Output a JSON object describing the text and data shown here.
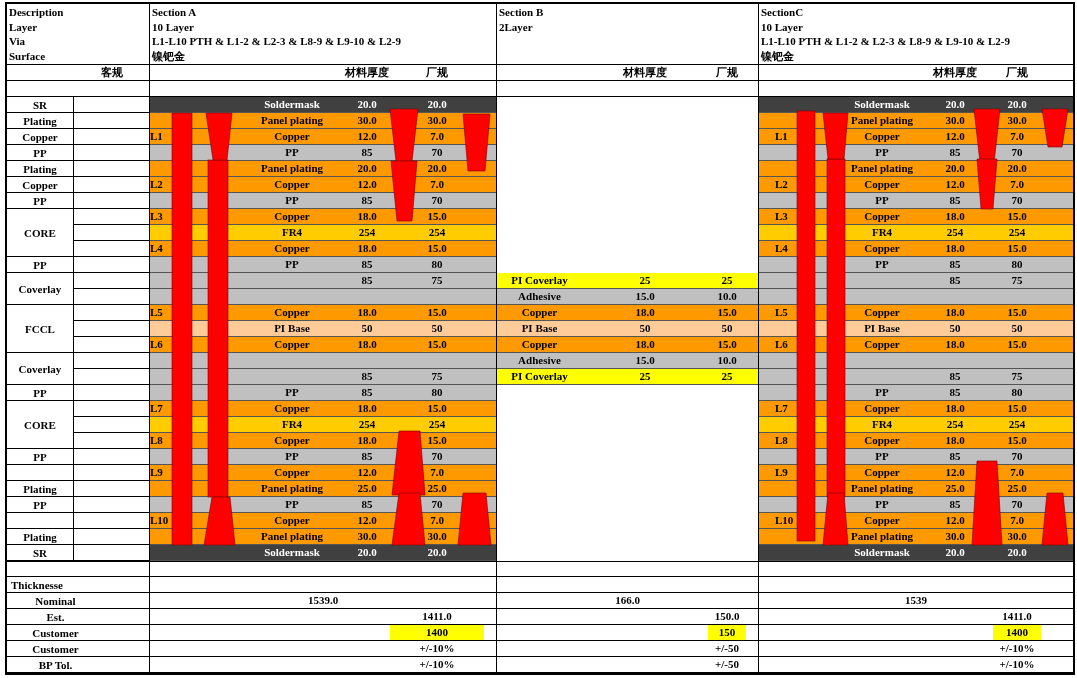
{
  "description_labels": [
    "Description",
    "Layer",
    "Via",
    "Surface"
  ],
  "customer_spec_heading": "客规",
  "stack_labels": [
    {
      "text": "SR"
    },
    {
      "text": "Plating"
    },
    {
      "text": "Copper"
    },
    {
      "text": "PP"
    },
    {
      "text": "Plating"
    },
    {
      "text": "Copper"
    },
    {
      "text": "PP"
    },
    {
      "text": "CORE"
    },
    {
      "text": "PP"
    },
    {
      "text": "Coverlay"
    },
    {
      "text": "FCCL"
    },
    {
      "text": "Coverlay"
    },
    {
      "text": "PP"
    },
    {
      "text": "CORE"
    },
    {
      "text": "PP"
    },
    {
      "text": "Plating"
    },
    {
      "text": "PP"
    },
    {
      "text": "Plating"
    },
    {
      "text": "SR"
    }
  ],
  "sections": [
    {
      "title": "Section A",
      "layers": "10 Layer",
      "via": "L1-L10 PTH  & L1-2 & L2-3 & L8-9 & L9-10 & L2-9",
      "surface": "镍钯金",
      "thickness_heading": "材料厚度",
      "factory_heading": "厂规",
      "rows": [
        {
          "kind": "soldermask",
          "material": "Soldermask",
          "thickness": "20.0",
          "factory": "20.0"
        },
        {
          "kind": "plating",
          "material": "Panel plating",
          "thickness": "30.0",
          "factory": "30.0"
        },
        {
          "kind": "copper",
          "layer": "L1",
          "material": "Copper",
          "thickness": "12.0",
          "factory": "7.0"
        },
        {
          "kind": "pp",
          "material": "PP",
          "thickness": "85",
          "factory": "70"
        },
        {
          "kind": "plating",
          "material": "Panel plating",
          "thickness": "20.0",
          "factory": "20.0"
        },
        {
          "kind": "copper",
          "layer": "L2",
          "material": "Copper",
          "thickness": "12.0",
          "factory": "7.0"
        },
        {
          "kind": "pp",
          "material": "PP",
          "thickness": "85",
          "factory": "70"
        },
        {
          "kind": "copper",
          "layer": "L3",
          "material": "Copper",
          "thickness": "18.0",
          "factory": "15.0"
        },
        {
          "kind": "fr4",
          "material": "FR4",
          "thickness": "254",
          "factory": "254"
        },
        {
          "kind": "copper",
          "layer": "L4",
          "material": "Copper",
          "thickness": "18.0",
          "factory": "15.0"
        },
        {
          "kind": "pp",
          "material": "PP",
          "thickness": "85",
          "factory": "80"
        },
        {
          "kind": "pp",
          "thickness": "85",
          "factory": "75"
        },
        {
          "kind": "pp"
        },
        {
          "kind": "copper",
          "layer": "L5",
          "material": "Copper",
          "thickness": "18.0",
          "factory": "15.0"
        },
        {
          "kind": "pi_base",
          "material": "PI Base",
          "thickness": "50",
          "factory": "50"
        },
        {
          "kind": "copper",
          "layer": "L6",
          "material": "Copper",
          "thickness": "18.0",
          "factory": "15.0"
        },
        {
          "kind": "pp"
        },
        {
          "kind": "pp",
          "thickness": "85",
          "factory": "75"
        },
        {
          "kind": "pp",
          "material": "PP",
          "thickness": "85",
          "factory": "80"
        },
        {
          "kind": "copper",
          "layer": "L7",
          "material": "Copper",
          "thickness": "18.0",
          "factory": "15.0"
        },
        {
          "kind": "fr4",
          "material": "FR4",
          "thickness": "254",
          "factory": "254"
        },
        {
          "kind": "copper",
          "layer": "L8",
          "material": "Copper",
          "thickness": "18.0",
          "factory": "15.0"
        },
        {
          "kind": "pp",
          "material": "PP",
          "thickness": "85",
          "factory": "70"
        },
        {
          "kind": "copper",
          "layer": "L9",
          "material": "Copper",
          "thickness": "12.0",
          "factory": "7.0"
        },
        {
          "kind": "plating",
          "material": "Panel plating",
          "thickness": "25.0",
          "factory": "25.0"
        },
        {
          "kind": "pp",
          "material": "PP",
          "thickness": "85",
          "factory": "70"
        },
        {
          "kind": "copper",
          "layer": "L10",
          "material": "Copper",
          "thickness": "12.0",
          "factory": "7.0"
        },
        {
          "kind": "plating",
          "material": "Panel plating",
          "thickness": "30.0",
          "factory": "30.0"
        },
        {
          "kind": "soldermask",
          "material": "Soldermask",
          "thickness": "20.0",
          "factory": "20.0"
        }
      ]
    },
    {
      "title": "Section B",
      "layers": "2Layer",
      "thickness_heading": "材料厚度",
      "factory_heading": "厂规",
      "rows": [
        {
          "kind": "blank"
        },
        {
          "kind": "blank"
        },
        {
          "kind": "blank"
        },
        {
          "kind": "blank"
        },
        {
          "kind": "blank"
        },
        {
          "kind": "blank"
        },
        {
          "kind": "blank"
        },
        {
          "kind": "blank"
        },
        {
          "kind": "blank"
        },
        {
          "kind": "blank"
        },
        {
          "kind": "blank"
        },
        {
          "kind": "coverlay",
          "material": "PI Coverlay",
          "thickness": "25",
          "factory": "25"
        },
        {
          "kind": "adhesive",
          "material": "Adhesive",
          "thickness": "15.0",
          "factory": "10.0"
        },
        {
          "kind": "copper",
          "material": "Copper",
          "thickness": "18.0",
          "factory": "15.0"
        },
        {
          "kind": "pi_base",
          "material": "PI Base",
          "thickness": "50",
          "factory": "50"
        },
        {
          "kind": "copper",
          "material": "Copper",
          "thickness": "18.0",
          "factory": "15.0"
        },
        {
          "kind": "adhesive",
          "material": "Adhesive",
          "thickness": "15.0",
          "factory": "10.0"
        },
        {
          "kind": "coverlay",
          "material": "PI Coverlay",
          "thickness": "25",
          "factory": "25"
        },
        {
          "kind": "blank"
        },
        {
          "kind": "blank"
        },
        {
          "kind": "blank"
        },
        {
          "kind": "blank"
        },
        {
          "kind": "blank"
        },
        {
          "kind": "blank"
        },
        {
          "kind": "blank"
        },
        {
          "kind": "blank"
        },
        {
          "kind": "blank"
        },
        {
          "kind": "blank"
        },
        {
          "kind": "blank"
        },
        {
          "kind": "blank"
        },
        {
          "kind": "blank"
        }
      ]
    },
    {
      "title": "SectionC",
      "layers": "10 Layer",
      "via": "L1-L10 PTH  & L1-2 & L2-3 & L8-9 & L9-10 & L2-9",
      "surface": "镍钯金",
      "thickness_heading": "材料厚度",
      "factory_heading": "厂规",
      "rows": [
        {
          "kind": "soldermask",
          "material": "Soldermask",
          "thickness": "20.0",
          "factory": "20.0"
        },
        {
          "kind": "plating",
          "material": "Panel plating",
          "thickness": "30.0",
          "factory": "30.0"
        },
        {
          "kind": "copper",
          "layer": "L1",
          "material": "Copper",
          "thickness": "12.0",
          "factory": "7.0"
        },
        {
          "kind": "pp",
          "material": "PP",
          "thickness": "85",
          "factory": "70"
        },
        {
          "kind": "plating",
          "material": "Panel plating",
          "thickness": "20.0",
          "factory": "20.0"
        },
        {
          "kind": "copper",
          "layer": "L2",
          "material": "Copper",
          "thickness": "12.0",
          "factory": "7.0"
        },
        {
          "kind": "pp",
          "material": "PP",
          "thickness": "85",
          "factory": "70"
        },
        {
          "kind": "copper",
          "layer": "L3",
          "material": "Copper",
          "thickness": "18.0",
          "factory": "15.0"
        },
        {
          "kind": "fr4",
          "material": "FR4",
          "thickness": "254",
          "factory": "254"
        },
        {
          "kind": "copper",
          "layer": "L4",
          "material": "Copper",
          "thickness": "18.0",
          "factory": "15.0"
        },
        {
          "kind": "pp",
          "material": "PP",
          "thickness": "85",
          "factory": "80"
        },
        {
          "kind": "pp",
          "thickness": "85",
          "factory": "75"
        },
        {
          "kind": "pp"
        },
        {
          "kind": "copper",
          "layer": "L5",
          "material": "Copper",
          "thickness": "18.0",
          "factory": "15.0"
        },
        {
          "kind": "pi_base",
          "material": "PI Base",
          "thickness": "50",
          "factory": "50"
        },
        {
          "kind": "copper",
          "layer": "L6",
          "material": "Copper",
          "thickness": "18.0",
          "factory": "15.0"
        },
        {
          "kind": "pp"
        },
        {
          "kind": "pp",
          "thickness": "85",
          "factory": "75"
        },
        {
          "kind": "pp",
          "material": "PP",
          "thickness": "85",
          "factory": "80"
        },
        {
          "kind": "copper",
          "layer": "L7",
          "material": "Copper",
          "thickness": "18.0",
          "factory": "15.0"
        },
        {
          "kind": "fr4",
          "material": "FR4",
          "thickness": "254",
          "factory": "254"
        },
        {
          "kind": "copper",
          "layer": "L8",
          "material": "Copper",
          "thickness": "18.0",
          "factory": "15.0"
        },
        {
          "kind": "pp",
          "material": "PP",
          "thickness": "85",
          "factory": "70"
        },
        {
          "kind": "copper",
          "layer": "L9",
          "material": "Copper",
          "thickness": "12.0",
          "factory": "7.0"
        },
        {
          "kind": "plating",
          "material": "Panel plating",
          "thickness": "25.0",
          "factory": "25.0"
        },
        {
          "kind": "pp",
          "material": "PP",
          "thickness": "85",
          "factory": "70"
        },
        {
          "kind": "copper",
          "layer": "L10",
          "material": "Copper",
          "thickness": "12.0",
          "factory": "7.0"
        },
        {
          "kind": "plating",
          "material": "Panel plating",
          "thickness": "30.0",
          "factory": "30.0"
        },
        {
          "kind": "soldermask",
          "material": "Soldermask",
          "thickness": "20.0",
          "factory": "20.0"
        }
      ]
    }
  ],
  "summary": [
    {
      "kind": "heading",
      "label": "Thicknesse"
    },
    {
      "kind": "total",
      "label": "Nominal",
      "values": [
        "1539.0",
        "166.0",
        "1539"
      ]
    },
    {
      "kind": "factory",
      "label": "Est.",
      "values": [
        "1411.0",
        "150.0",
        "1411.0"
      ],
      "highlighted": false
    },
    {
      "kind": "factory",
      "label": "Customer",
      "values": [
        "1400",
        "150",
        "1400"
      ],
      "highlighted": true
    },
    {
      "kind": "factory",
      "label": "Customer",
      "values": [
        "+/-10%",
        "+/-50",
        "+/-10%"
      ],
      "highlighted": false
    },
    {
      "kind": "factory",
      "label": "BP Tol.",
      "values": [
        "+/-10%",
        "+/-50",
        "+/-10%"
      ],
      "highlighted": false
    }
  ]
}
